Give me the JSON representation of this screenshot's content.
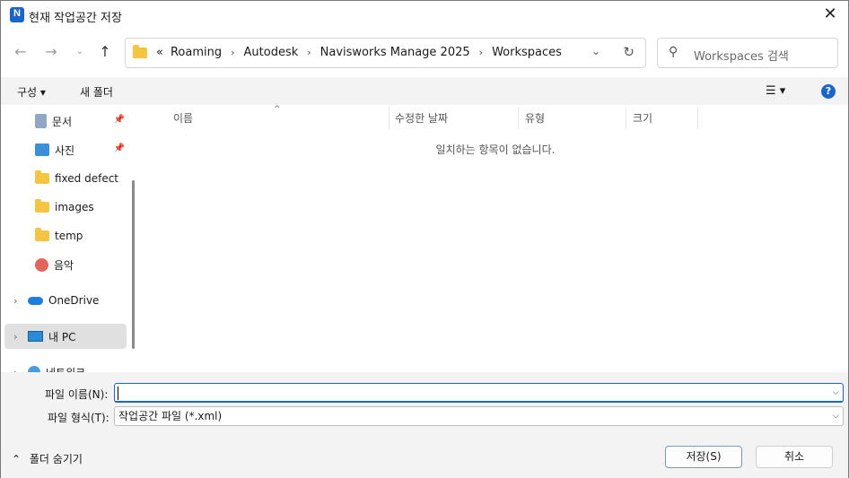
{
  "window": {
    "title": "현재 작업공간 저장",
    "app_icon_letter": "N"
  },
  "nav": {
    "breadcrumb_overflow": "«",
    "breadcrumbs": [
      "Roaming",
      "Autodesk",
      "Navisworks Manage 2025",
      "Workspaces"
    ],
    "search_placeholder": "Workspaces 검색"
  },
  "toolbar": {
    "organize": "구성 ▾",
    "new_folder": "새 폴더",
    "help": "?"
  },
  "sidebar": {
    "items": [
      {
        "label": "문서",
        "icon": "documents-icon",
        "pinned": true
      },
      {
        "label": "사진",
        "icon": "pictures-icon",
        "pinned": true
      },
      {
        "label": "fixed defect",
        "icon": "folder-icon"
      },
      {
        "label": "images",
        "icon": "folder-icon"
      },
      {
        "label": "temp",
        "icon": "folder-icon"
      },
      {
        "label": "음악",
        "icon": "music-icon"
      },
      {
        "label": "OneDrive",
        "icon": "onedrive-icon"
      },
      {
        "label": "내 PC",
        "icon": "pc-icon"
      },
      {
        "label": "네트워크",
        "icon": "network-icon"
      }
    ]
  },
  "content": {
    "columns": [
      "이름",
      "수정한 날짜",
      "유형",
      "크기"
    ],
    "empty_message": "일치하는 항목이 없습니다."
  },
  "form": {
    "filename_label": "파일 이름(N):",
    "filename_value": "",
    "filetype_label": "파일 형식(T):",
    "filetype_value": "작업공간 파일 (*.xml)",
    "hide_folders": "폴더 숨기기",
    "save_button": "저장(S)",
    "cancel_button": "취소"
  },
  "colors": {
    "accent": "#1b64c8",
    "folder": "#f5c542"
  }
}
